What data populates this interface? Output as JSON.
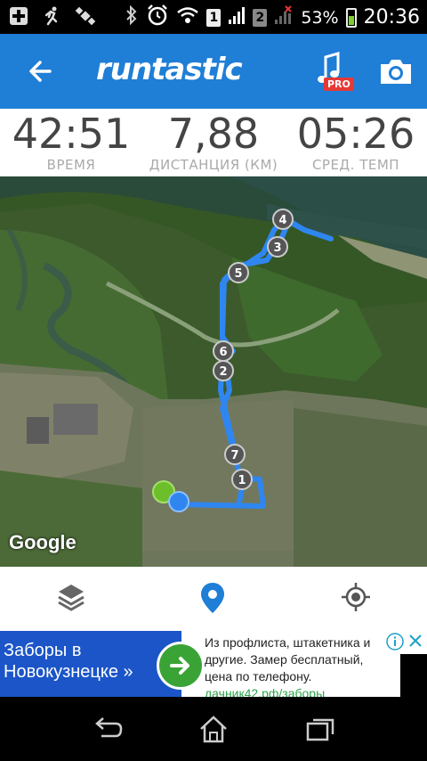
{
  "status_bar": {
    "sim1": "1",
    "sim2": "2",
    "battery_percent": "53%",
    "battery_level": 0.53,
    "time": "20:36",
    "icons": [
      "add-box-icon",
      "running-icon",
      "satellite-icon",
      "bluetooth-icon",
      "alarm-icon",
      "wifi-icon",
      "signal-icon",
      "battery-icon"
    ]
  },
  "app_bar": {
    "logo": "runtastic",
    "pro_badge": "PRO",
    "icons": [
      "back-arrow-icon",
      "music-icon",
      "camera-icon"
    ]
  },
  "stats": [
    {
      "value": "42:51",
      "label": "ВРЕМЯ"
    },
    {
      "value": "7,88",
      "label": "ДИСТАНЦИЯ (КМ)"
    },
    {
      "value": "05:26",
      "label": "СРЕД. ТЕМП"
    }
  ],
  "map": {
    "attribution": "Google",
    "markers": [
      "1",
      "2",
      "3",
      "4",
      "5",
      "6",
      "7"
    ],
    "route_color": "#2f86f0"
  },
  "controls": {
    "icons": [
      "layers-icon",
      "location-pin-icon",
      "my-location-icon"
    ],
    "active_color": "#1f7ed6"
  },
  "ad": {
    "headline": "Заборы в Новокузнецке »",
    "body": "Из профлиста, штакетника и другие. Замер бесплатный, цена по телефону.",
    "url": "дачник42.рф/заборы"
  },
  "nav_bar": {
    "icons": [
      "back-icon",
      "home-icon",
      "recents-icon"
    ]
  }
}
